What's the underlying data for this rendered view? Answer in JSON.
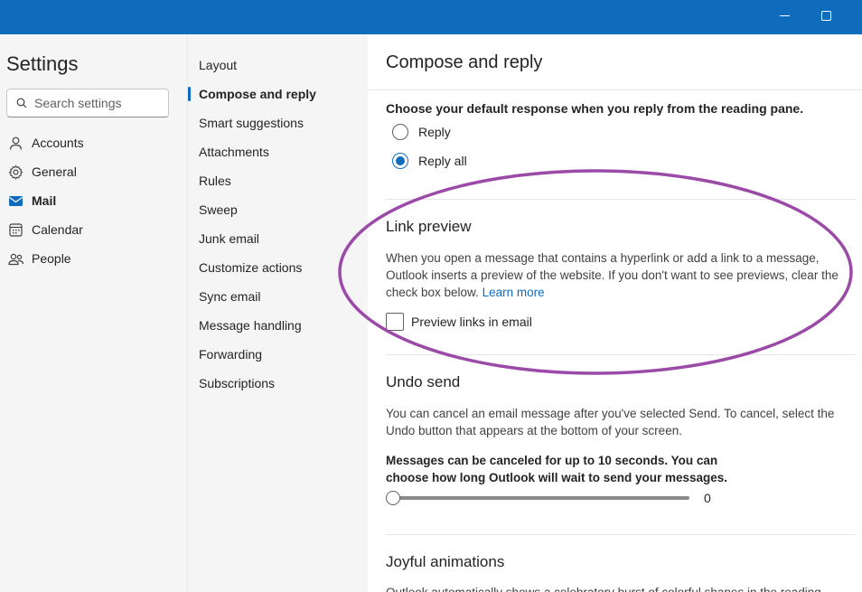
{
  "window": {
    "accent": "#0f6cbd"
  },
  "sidebar": {
    "title": "Settings",
    "search_placeholder": "Search settings",
    "items": [
      {
        "label": "Accounts",
        "icon": "person-icon"
      },
      {
        "label": "General",
        "icon": "gear-icon"
      },
      {
        "label": "Mail",
        "icon": "mail-icon"
      },
      {
        "label": "Calendar",
        "icon": "calendar-icon"
      },
      {
        "label": "People",
        "icon": "people-icon"
      }
    ]
  },
  "submenu": {
    "items": [
      "Layout",
      "Compose and reply",
      "Smart suggestions",
      "Attachments",
      "Rules",
      "Sweep",
      "Junk email",
      "Customize actions",
      "Sync email",
      "Message handling",
      "Forwarding",
      "Subscriptions"
    ]
  },
  "main": {
    "title": "Compose and reply",
    "reply_section": {
      "question": "Choose your default response when you reply from the reading pane.",
      "options": [
        "Reply",
        "Reply all"
      ],
      "selected": "Reply all"
    },
    "link_preview": {
      "title": "Link preview",
      "desc1": "When you open a message that contains a hyperlink or add a link to a message,",
      "desc2": "Outlook inserts a preview of the website. If you don't want to see previews, clear the",
      "desc3": "check box below.",
      "learn_more": "Learn more",
      "checkbox_label": "Preview links in email",
      "checked": false
    },
    "undo_send": {
      "title": "Undo send",
      "desc1": "You can cancel an email message after you've selected Send. To cancel, select the",
      "desc2": "Undo button that appears at the bottom of your screen.",
      "bold1": "Messages can be canceled for up to 10 seconds. You can",
      "bold2": "choose how long Outlook will wait to send your messages.",
      "slider_value": "0"
    },
    "joyful": {
      "title": "Joyful animations",
      "desc1": "Outlook automatically shows a celebratory burst of colorful shapes in the reading"
    }
  },
  "annotation": {
    "color": "#9b4aa8"
  }
}
